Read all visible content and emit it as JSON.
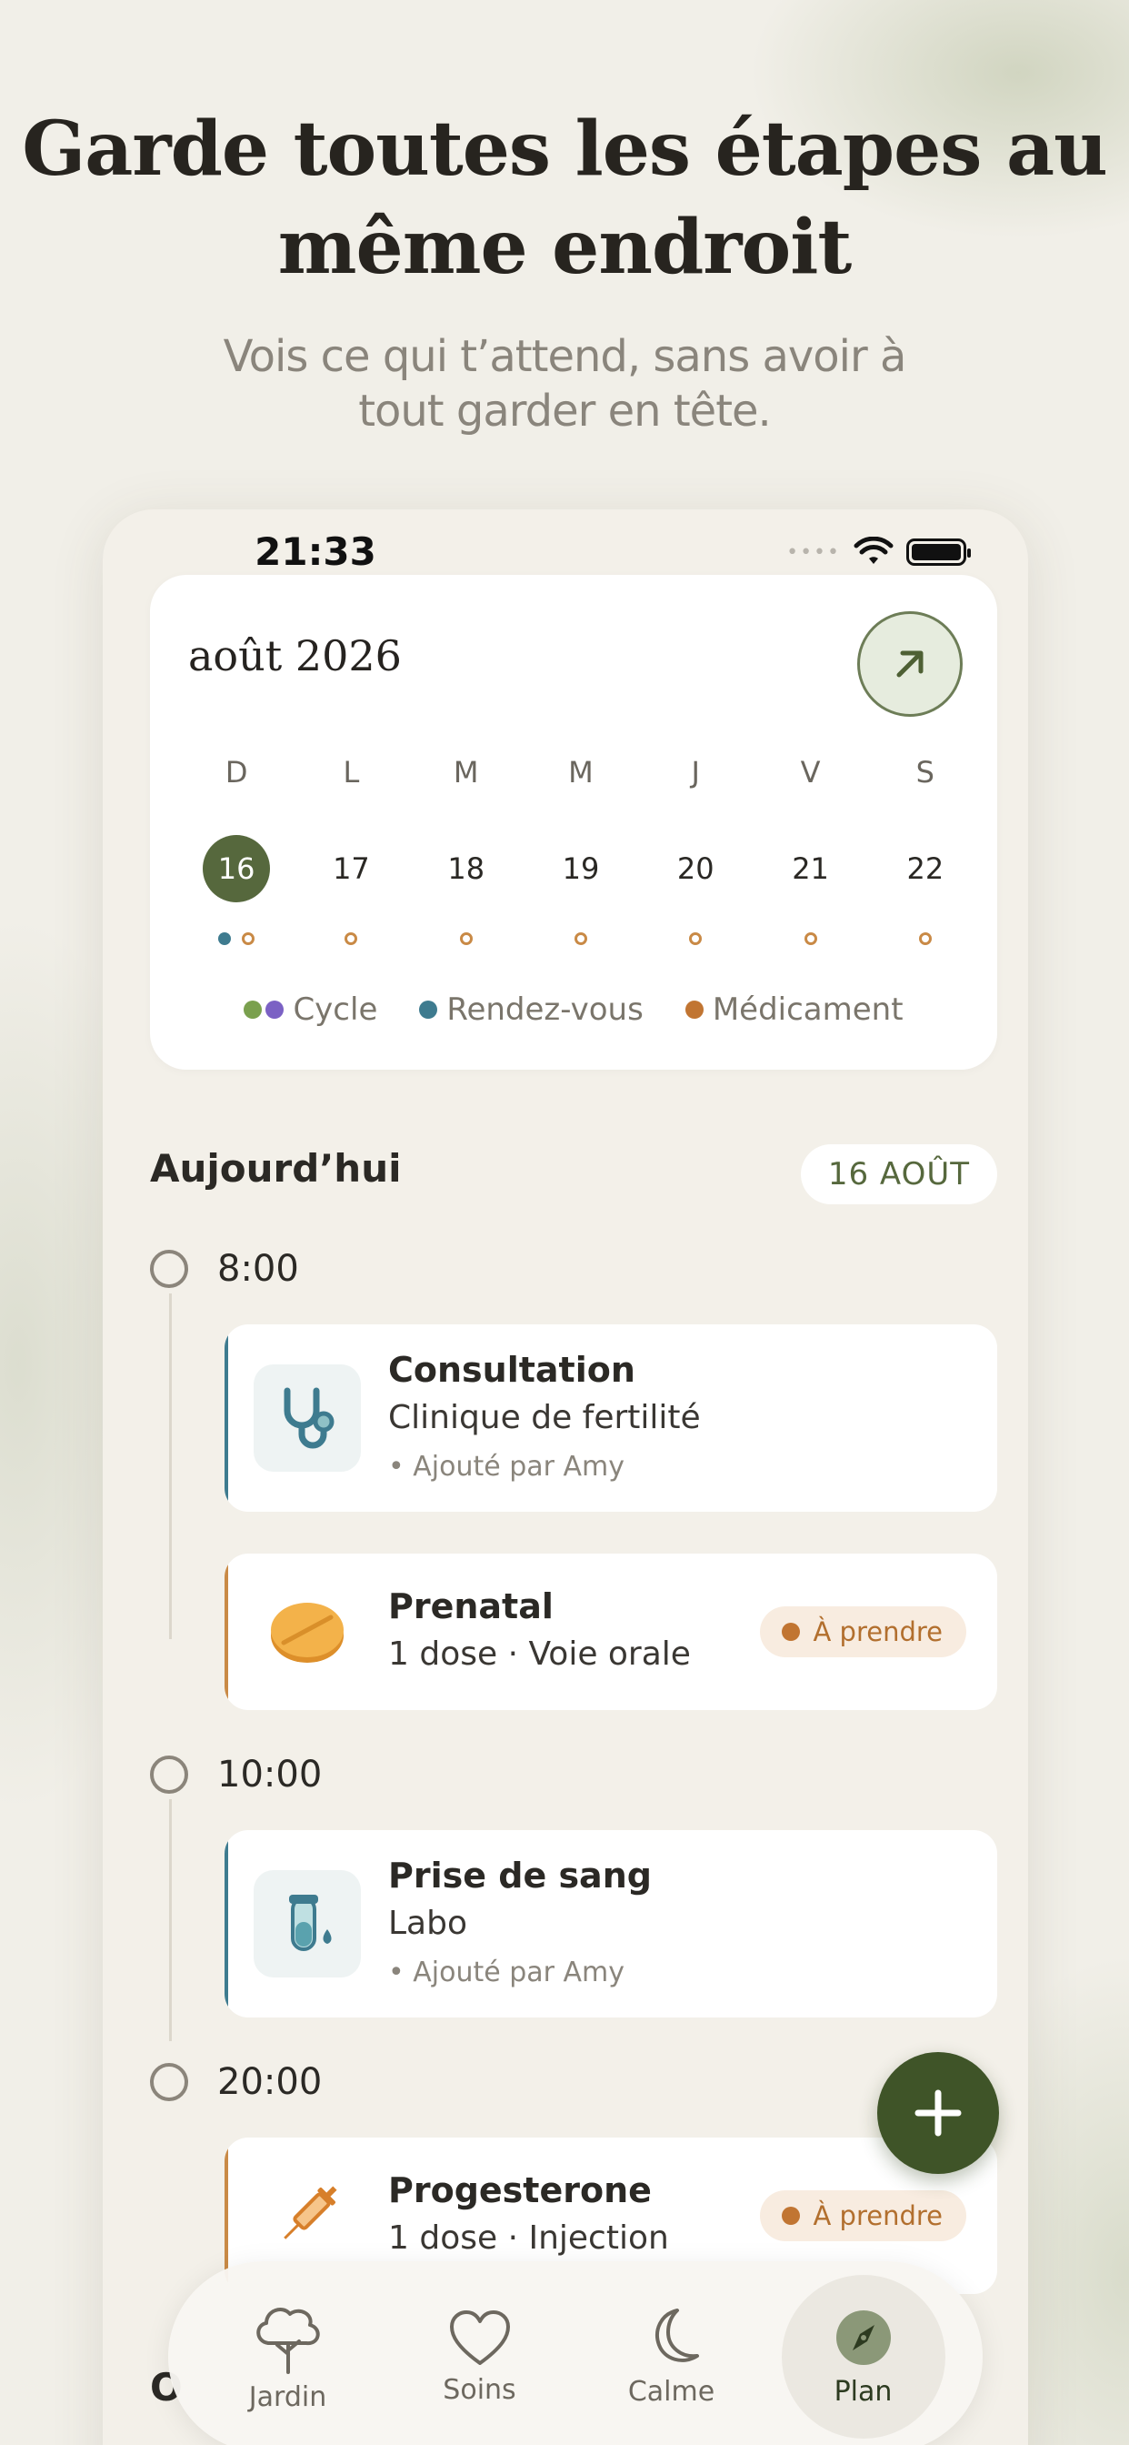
{
  "headline": {
    "line1": "Garde toutes les étapes au",
    "line2": "même endroit"
  },
  "subline": {
    "line1": "Vois ce qui t’attend, sans avoir à",
    "line2": "tout garder en tête."
  },
  "status_bar": {
    "time": "21:33",
    "signal": "••••"
  },
  "calendar": {
    "month": "août 2026",
    "weekdays": [
      "D",
      "L",
      "M",
      "M",
      "J",
      "V",
      "S"
    ],
    "dates": [
      "16",
      "17",
      "18",
      "19",
      "20",
      "21",
      "22"
    ],
    "selected_date": "16",
    "legend": [
      {
        "label": "Cycle",
        "colors": [
          "#7aa04e",
          "#7b61c4"
        ]
      },
      {
        "label": "Rendez-vous",
        "colors": [
          "#3e7b8f"
        ]
      },
      {
        "label": "Médicament",
        "colors": [
          "#c17532"
        ]
      }
    ]
  },
  "today": {
    "title": "Aujourd’hui",
    "date_pill": "16 AOÛT"
  },
  "timeline": [
    {
      "time": "8:00",
      "events": [
        {
          "type": "appointment",
          "icon": "stethoscope-icon",
          "title": "Consultation",
          "subtitle": "Clinique de fertilité",
          "meta": "• Ajouté par Amy"
        },
        {
          "type": "medication",
          "icon": "pill-icon",
          "title": "Prenatal",
          "subtitle": "1 dose · Voie orale",
          "badge": "À prendre"
        }
      ]
    },
    {
      "time": "10:00",
      "events": [
        {
          "type": "appointment",
          "icon": "test-tube-icon",
          "title": "Prise de sang",
          "subtitle": "Labo",
          "meta": "• Ajouté par Amy"
        }
      ]
    },
    {
      "time": "20:00",
      "events": [
        {
          "type": "medication",
          "icon": "syringe-icon",
          "title": "Progesterone",
          "subtitle": "1 dose · Injection",
          "badge": "À prendre"
        }
      ]
    }
  ],
  "peek_text": "O",
  "tabbar": [
    {
      "label": "Jardin",
      "icon": "tree-icon"
    },
    {
      "label": "Soins",
      "icon": "heart-icon"
    },
    {
      "label": "Calme",
      "icon": "moon-icon"
    },
    {
      "label": "Plan",
      "icon": "compass-icon",
      "active": true
    }
  ],
  "colors": {
    "accent_green": "#56683d",
    "fab_green": "#3f5428",
    "appointment_blue": "#3e7b8f",
    "medication_orange": "#c17532"
  }
}
